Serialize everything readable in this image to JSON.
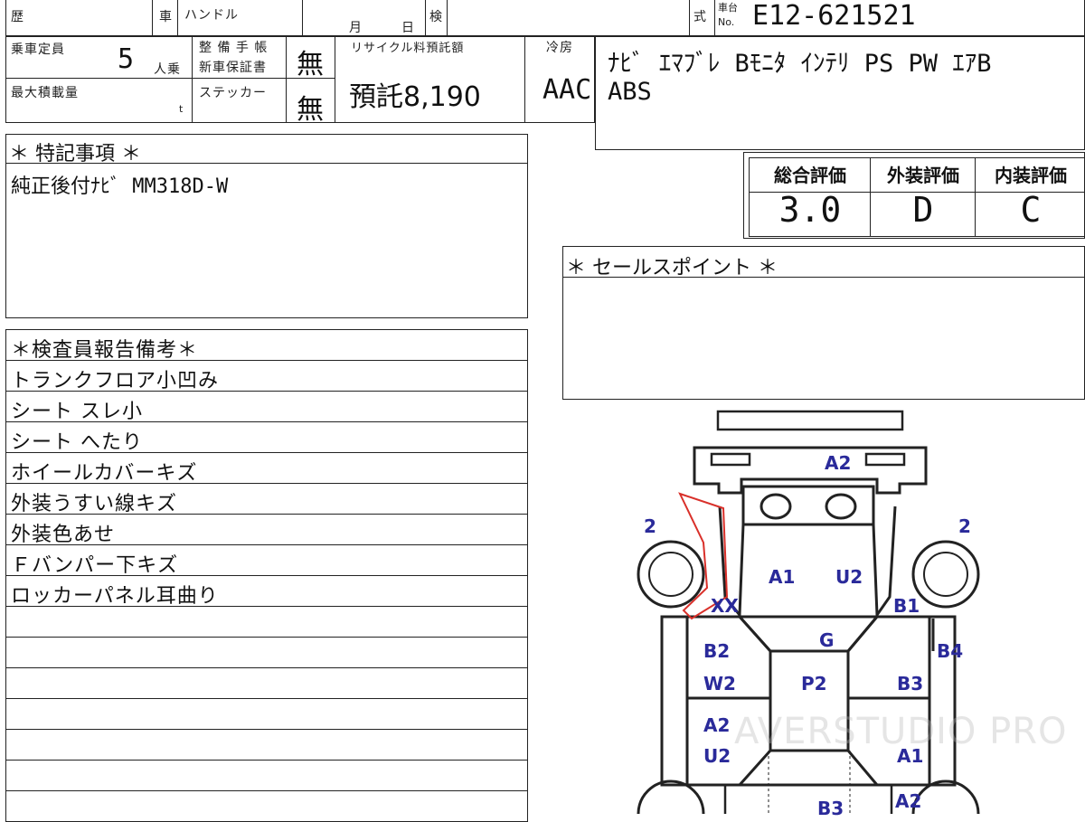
{
  "header": {
    "history_label": "歴",
    "car_label": "車",
    "handle_label": "ハンドル",
    "month_label": "月",
    "day_label": "日",
    "inspect_label": "検",
    "model_label": "式",
    "chassis_no_label_top": "車台",
    "chassis_no_label_bottom": "No.",
    "chassis_no": "E12-621521"
  },
  "specs": {
    "capacity_label": "乗車定員",
    "capacity_value": "5",
    "capacity_unit": "人乗",
    "max_load_label": "最大積載量",
    "max_load_unit": "t",
    "maintenance_label_1": "整 備 手 帳",
    "maintenance_label_2": "新車保証書",
    "maintenance_value": "無",
    "sticker_label": "ステッカー",
    "sticker_value": "無",
    "recycle_label": "リサイクル料預託額",
    "recycle_value": "預託8,190",
    "aircon_label": "冷房",
    "aircon_value": "AAC"
  },
  "equipment": {
    "line1": "ﾅﾋﾞ ｴﾏﾌﾞﾚ Bﾓﾆﾀ ｲﾝﾃﾘ PS PW ｴｱB",
    "line2": "ABS"
  },
  "special_notes": {
    "title": "＊ 特記事項 ＊",
    "text": "純正後付ﾅﾋﾞ MM318D-W"
  },
  "grades": {
    "overall_label": "総合評価",
    "overall_value": "3.0",
    "exterior_label": "外装評価",
    "exterior_value": "D",
    "interior_label": "内装評価",
    "interior_value": "C"
  },
  "sales_point": {
    "title": "＊ セールスポイント ＊"
  },
  "inspector_report": {
    "title": "＊検査員報告備考＊",
    "items": [
      "トランクフロア小凹み",
      "シート スレ小",
      "シート へたり",
      "ホイールカバーキズ",
      "外装うすい線キズ",
      "外装色あせ",
      "Ｆバンパー下キズ",
      "ロッカーパネル耳曲り"
    ]
  },
  "diagram_marks": {
    "a2_top": "A2",
    "left_2": "2",
    "right_2": "2",
    "a1_hood": "A1",
    "u2_hood": "U2",
    "xx_left": "XX",
    "b1_right": "B1",
    "b4_right": "B4",
    "g_windshield": "G",
    "b2_left": "B2",
    "w2_left": "W2",
    "p2_roof": "P2",
    "b3_right": "B3",
    "a2_left": "A2",
    "u2_left": "U2",
    "a1_right": "A1",
    "a2_right_bottom": "A2",
    "b3_bottom": "B3"
  },
  "watermark": "AVERSTUDIO PRO",
  "colors": {
    "line": "#222222",
    "mark_blue": "#2a2a9a",
    "damage_red": "#d9302a"
  }
}
